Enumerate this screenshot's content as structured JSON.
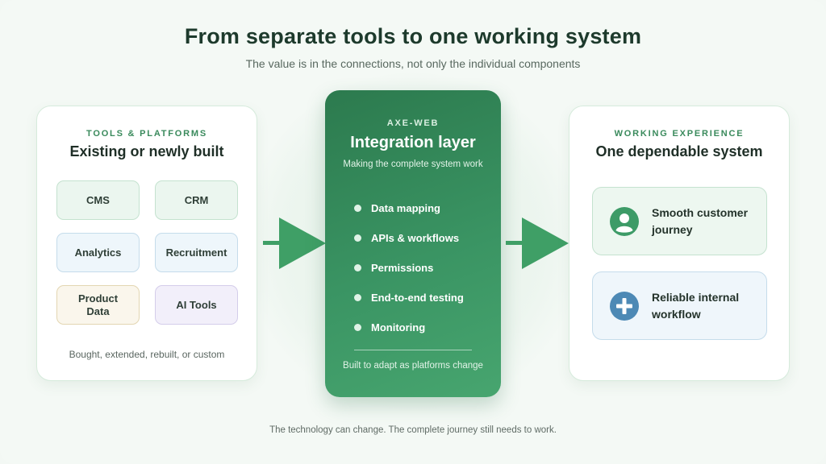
{
  "title": "From separate tools to one working system",
  "subtitle": "The value is in the connections, not only the individual components",
  "left_card": {
    "eyebrow": "TOOLS & PLATFORMS",
    "heading": "Existing or newly built",
    "tools": [
      "CMS",
      "CRM",
      "Analytics",
      "Recruitment",
      "Product Data",
      "AI Tools"
    ],
    "footnote": "Bought, extended, rebuilt, or custom"
  },
  "center_card": {
    "eyebrow": "AXE-WEB",
    "title": "Integration layer",
    "subtitle": "Making the complete system work",
    "items": [
      "Data mapping",
      "APIs & workflows",
      "Permissions",
      "End-to-end testing",
      "Monitoring"
    ],
    "footnote": "Built to adapt as platforms change"
  },
  "right_card": {
    "eyebrow": "WORKING EXPERIENCE",
    "heading": "One dependable system",
    "outcomes": [
      {
        "icon": "person-icon",
        "line1": "Smooth customer",
        "line2": "journey"
      },
      {
        "icon": "plus-icon",
        "line1": "Reliable internal",
        "line2": "workflow"
      }
    ]
  },
  "bottom_note": "The technology can change. The complete journey still needs to work.",
  "colors": {
    "accent_green": "#3a9463",
    "dark_text": "#1d3a2c",
    "person_icon": "#3d9b67",
    "plus_icon": "#4d89b5"
  }
}
